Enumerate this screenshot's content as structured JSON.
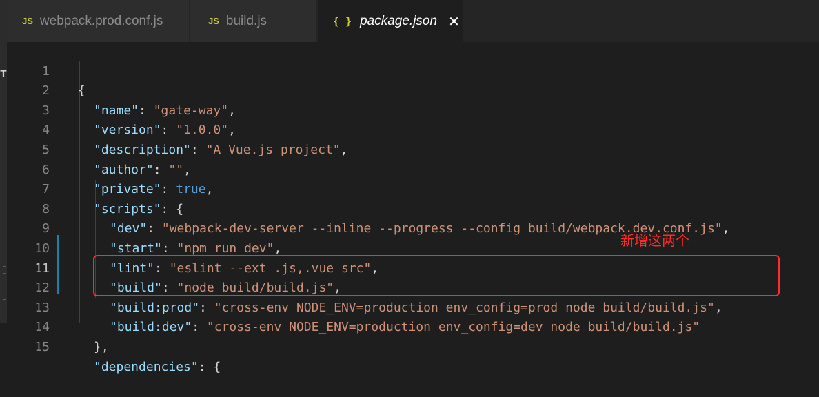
{
  "tabs": [
    {
      "label": "webpack.prod.conf.js",
      "icon": "JS",
      "active": false
    },
    {
      "label": "build.js",
      "icon": "JS",
      "active": false
    },
    {
      "label": "package.json",
      "icon": "{ }",
      "active": true,
      "close": "✕"
    }
  ],
  "activity_mark": "T",
  "lines": [
    {
      "n": "1"
    },
    {
      "n": "2"
    },
    {
      "n": "3"
    },
    {
      "n": "4"
    },
    {
      "n": "5"
    },
    {
      "n": "6"
    },
    {
      "n": "7"
    },
    {
      "n": "8"
    },
    {
      "n": "9"
    },
    {
      "n": "10"
    },
    {
      "n": "11"
    },
    {
      "n": "12"
    },
    {
      "n": "13"
    },
    {
      "n": "14"
    },
    {
      "n": "15"
    }
  ],
  "code": {
    "l1": {
      "brace": "{"
    },
    "l2": {
      "key": "\"name\"",
      "val": "\"gate-way\""
    },
    "l3": {
      "key": "\"version\"",
      "val": "\"1.0.0\""
    },
    "l4": {
      "key": "\"description\"",
      "val": "\"A Vue.js project\""
    },
    "l5": {
      "key": "\"author\"",
      "val": "\"\""
    },
    "l6": {
      "key": "\"private\"",
      "val": "true"
    },
    "l7": {
      "key": "\"scripts\"",
      "brace": "{"
    },
    "l8": {
      "key": "\"dev\"",
      "val": "\"webpack-dev-server --inline --progress --config build/webpack.dev.conf.js\""
    },
    "l9": {
      "key": "\"start\"",
      "val": "\"npm run dev\""
    },
    "l10": {
      "key": "\"lint\"",
      "val": "\"eslint --ext .js,.vue src\""
    },
    "l11": {
      "key": "\"build\"",
      "val": "\"node build/build.js\""
    },
    "l12": {
      "key": "\"build:prod\"",
      "val": "\"cross-env NODE_ENV=production env_config=prod node build/build.js\""
    },
    "l13": {
      "key": "\"build:dev\"",
      "val": "\"cross-env NODE_ENV=production env_config=dev node build/build.js\""
    },
    "l14": {
      "brace": "},"
    },
    "l15": {
      "key": "\"dependencies\"",
      "brace": "{"
    }
  },
  "annotation": "新增这两个",
  "colors": {
    "key": "#9cdcfe",
    "string": "#ce9178",
    "boolean": "#569cd6",
    "highlight": "#ff2d2d"
  }
}
